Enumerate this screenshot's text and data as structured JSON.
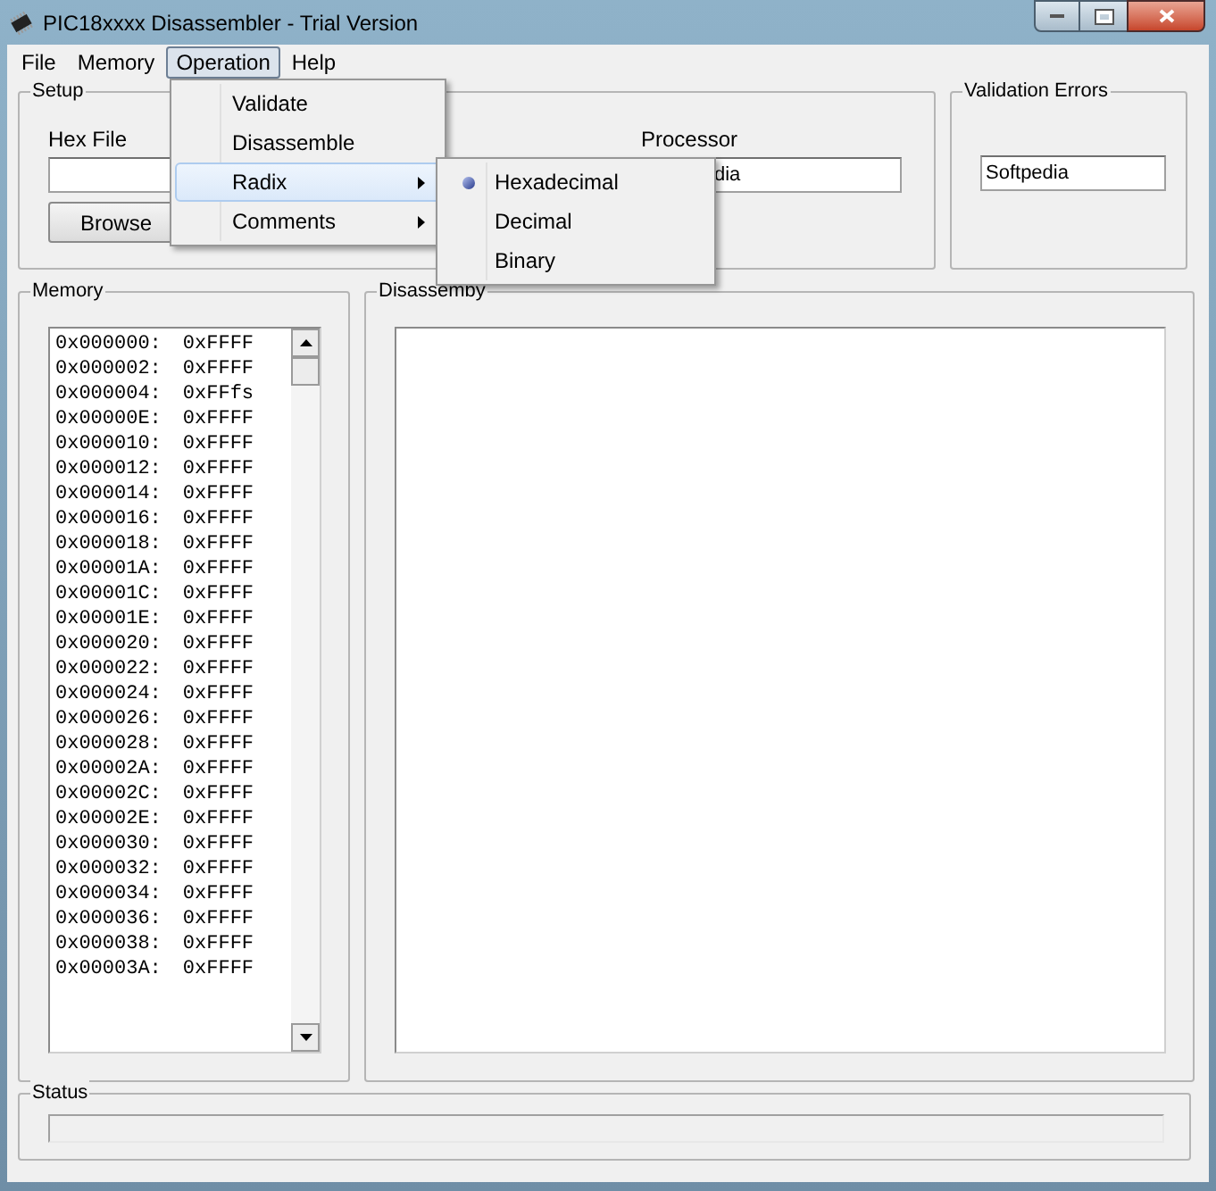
{
  "window": {
    "title": "PIC18xxxx Disassembler - Trial Version"
  },
  "menu_bar": [
    {
      "label": "File",
      "selected": false
    },
    {
      "label": "Memory",
      "selected": false
    },
    {
      "label": "Operation",
      "selected": true
    },
    {
      "label": "Help",
      "selected": false
    }
  ],
  "operation_menu": [
    {
      "label": "Validate",
      "kind": "item",
      "selected": false
    },
    {
      "label": "Disassemble",
      "kind": "item",
      "selected": false
    },
    {
      "label": "Radix",
      "kind": "submenu",
      "selected": true
    },
    {
      "label": "Comments",
      "kind": "submenu",
      "selected": false
    }
  ],
  "radix_submenu": [
    {
      "label": "Hexadecimal",
      "selected": true
    },
    {
      "label": "Decimal",
      "selected": false
    },
    {
      "label": "Binary",
      "selected": false
    }
  ],
  "setup": {
    "title": "Setup",
    "hex_file": {
      "label": "Hex File"
    },
    "browse_button": "Browse",
    "processor": {
      "label": "Processor",
      "value": "dia"
    }
  },
  "validation_errors": {
    "title": "Validation Errors",
    "value": "Softpedia"
  },
  "memory": {
    "title": "Memory",
    "rows": [
      {
        "address": "0x000000:",
        "value": "0xFFFF"
      },
      {
        "address": "0x000002:",
        "value": "0xFFFF"
      },
      {
        "address": "0x000004:",
        "value": "0xFFfs"
      },
      {
        "address": "0x00000E:",
        "value": "0xFFFF"
      },
      {
        "address": "0x000010:",
        "value": "0xFFFF"
      },
      {
        "address": "0x000012:",
        "value": "0xFFFF"
      },
      {
        "address": "0x000014:",
        "value": "0xFFFF"
      },
      {
        "address": "0x000016:",
        "value": "0xFFFF"
      },
      {
        "address": "0x000018:",
        "value": "0xFFFF"
      },
      {
        "address": "0x00001A:",
        "value": "0xFFFF"
      },
      {
        "address": "0x00001C:",
        "value": "0xFFFF"
      },
      {
        "address": "0x00001E:",
        "value": "0xFFFF"
      },
      {
        "address": "0x000020:",
        "value": "0xFFFF"
      },
      {
        "address": "0x000022:",
        "value": "0xFFFF"
      },
      {
        "address": "0x000024:",
        "value": "0xFFFF"
      },
      {
        "address": "0x000026:",
        "value": "0xFFFF"
      },
      {
        "address": "0x000028:",
        "value": "0xFFFF"
      },
      {
        "address": "0x00002A:",
        "value": "0xFFFF"
      },
      {
        "address": "0x00002C:",
        "value": "0xFFFF"
      },
      {
        "address": "0x00002E:",
        "value": "0xFFFF"
      },
      {
        "address": "0x000030:",
        "value": "0xFFFF"
      },
      {
        "address": "0x000032:",
        "value": "0xFFFF"
      },
      {
        "address": "0x000034:",
        "value": "0xFFFF"
      },
      {
        "address": "0x000036:",
        "value": "0xFFFF"
      },
      {
        "address": "0x000038:",
        "value": "0xFFFF"
      },
      {
        "address": "0x00003A:",
        "value": "0xFFFF"
      }
    ]
  },
  "disassembly": {
    "title": "Disassemby"
  },
  "status": {
    "title": "Status"
  }
}
